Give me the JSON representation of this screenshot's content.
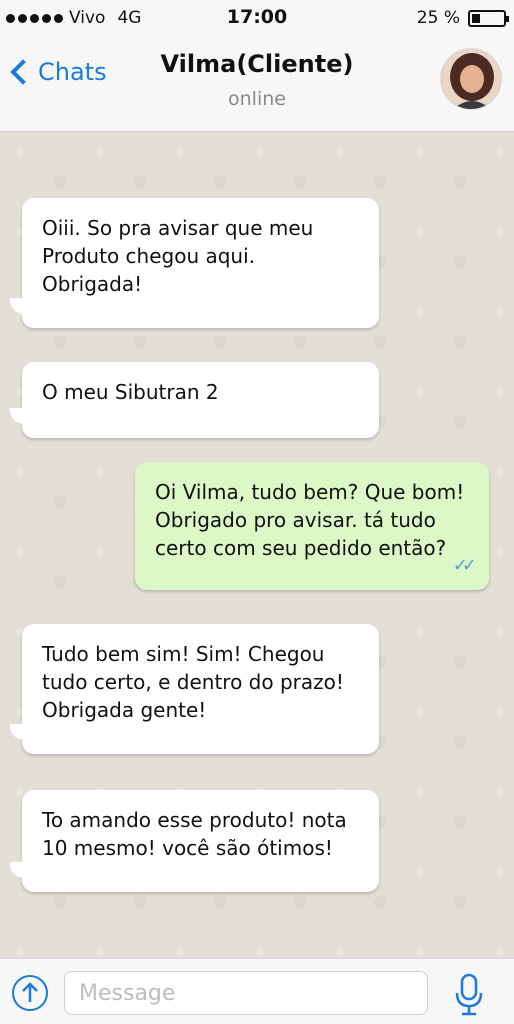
{
  "status_bar": {
    "carrier": "Vivo",
    "network": "4G",
    "time": "17:00",
    "battery": "25 %"
  },
  "header": {
    "back_label": "Chats",
    "contact_name": "Vilma(Cliente)",
    "contact_status": "online"
  },
  "messages": [
    {
      "direction": "in",
      "text": "Oiii. So pra avisar que meu Produto chegou aqui. Obrigada!"
    },
    {
      "direction": "in",
      "text": "O meu Sibutran 2"
    },
    {
      "direction": "out",
      "text": "Oi Vilma, tudo bem? Que bom! Obrigado pro avisar. tá tudo certo com seu pedido então?"
    },
    {
      "direction": "in",
      "text": "Tudo bem sim! Sim! Chegou tudo certo, e dentro do prazo! Obrigada gente!"
    },
    {
      "direction": "in",
      "text": "To amando esse produto! nota 10 mesmo! você são ótimos!"
    }
  ],
  "composer": {
    "placeholder": "Message"
  },
  "colors": {
    "accent": "#1a7bd8",
    "outgoing_bubble": "#dcf8c6",
    "incoming_bubble": "#ffffff",
    "chat_background": "#e4dfd6",
    "read_ticks": "#4da3e8"
  },
  "icons": [
    "signal-dots-icon",
    "battery-icon",
    "chevron-left-icon",
    "avatar",
    "read-ticks-icon",
    "upload-icon",
    "mic-icon"
  ]
}
